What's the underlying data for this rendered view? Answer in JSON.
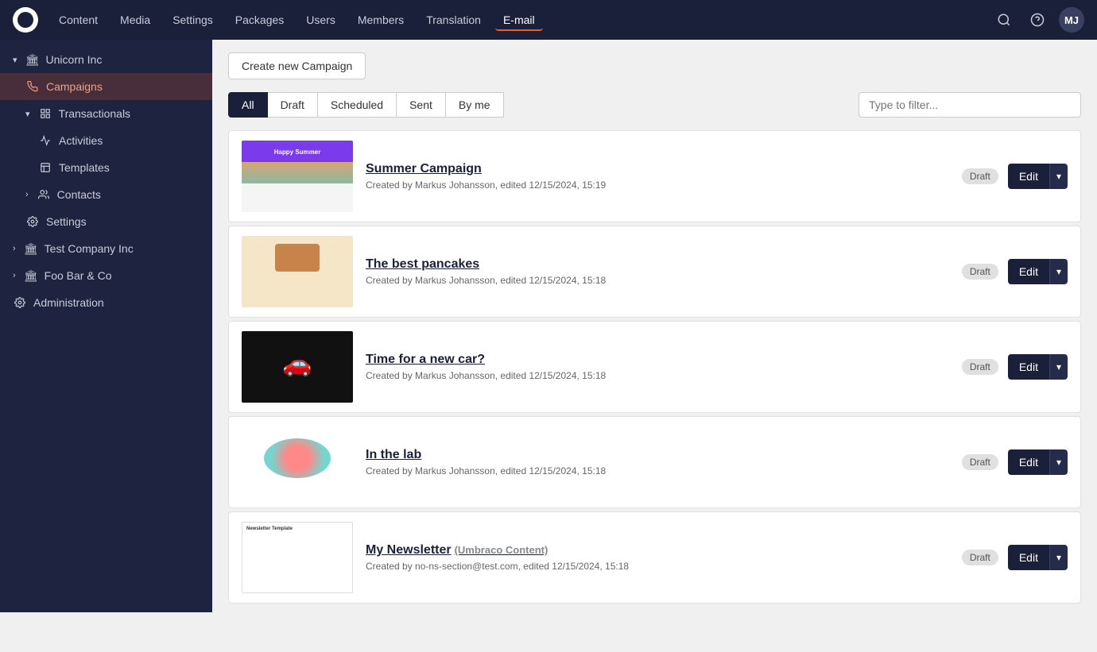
{
  "nav": {
    "items": [
      {
        "label": "Content",
        "active": false
      },
      {
        "label": "Media",
        "active": false
      },
      {
        "label": "Settings",
        "active": false
      },
      {
        "label": "Packages",
        "active": false
      },
      {
        "label": "Users",
        "active": false
      },
      {
        "label": "Members",
        "active": false
      },
      {
        "label": "Translation",
        "active": false
      },
      {
        "label": "E-mail",
        "active": true
      }
    ],
    "avatar_initials": "MJ"
  },
  "sidebar": {
    "unicorn": {
      "label": "Unicorn Inc",
      "campaigns_label": "Campaigns",
      "transactionals_label": "Transactionals",
      "activities_label": "Activities",
      "templates_label": "Templates",
      "contacts_label": "Contacts",
      "settings_label": "Settings"
    },
    "test_company": {
      "label": "Test Company Inc"
    },
    "foo_bar": {
      "label": "Foo Bar & Co"
    },
    "administration": {
      "label": "Administration"
    }
  },
  "toolbar": {
    "create_button_label": "Create new Campaign"
  },
  "filter_tabs": {
    "all": "All",
    "draft": "Draft",
    "scheduled": "Scheduled",
    "sent": "Sent",
    "by_me": "By me",
    "filter_placeholder": "Type to filter..."
  },
  "campaigns": [
    {
      "id": 1,
      "title": "Summer Campaign",
      "subtitle": "Created by Markus Johansson, edited 12/15/2024, 15:19",
      "status": "Draft",
      "thumb_class": "thumb-summer",
      "tag": ""
    },
    {
      "id": 2,
      "title": "The best pancakes",
      "subtitle": "Created by Markus Johansson, edited 12/15/2024, 15:18",
      "status": "Draft",
      "thumb_class": "thumb-pancakes",
      "tag": ""
    },
    {
      "id": 3,
      "title": "Time for a new car?",
      "subtitle": "Created by Markus Johansson, edited 12/15/2024, 15:18",
      "status": "Draft",
      "thumb_class": "thumb-car",
      "tag": ""
    },
    {
      "id": 4,
      "title": "In the lab",
      "subtitle": "Created by Markus Johansson, edited 12/15/2024, 15:18",
      "status": "Draft",
      "thumb_class": "thumb-lab",
      "tag": ""
    },
    {
      "id": 5,
      "title": "My Newsletter",
      "subtitle": "Created by no-ns-section@test.com, edited 12/15/2024, 15:18",
      "status": "Draft",
      "thumb_class": "thumb-newsletter",
      "tag": "(Umbraco Content)"
    }
  ],
  "buttons": {
    "edit_label": "Edit"
  }
}
